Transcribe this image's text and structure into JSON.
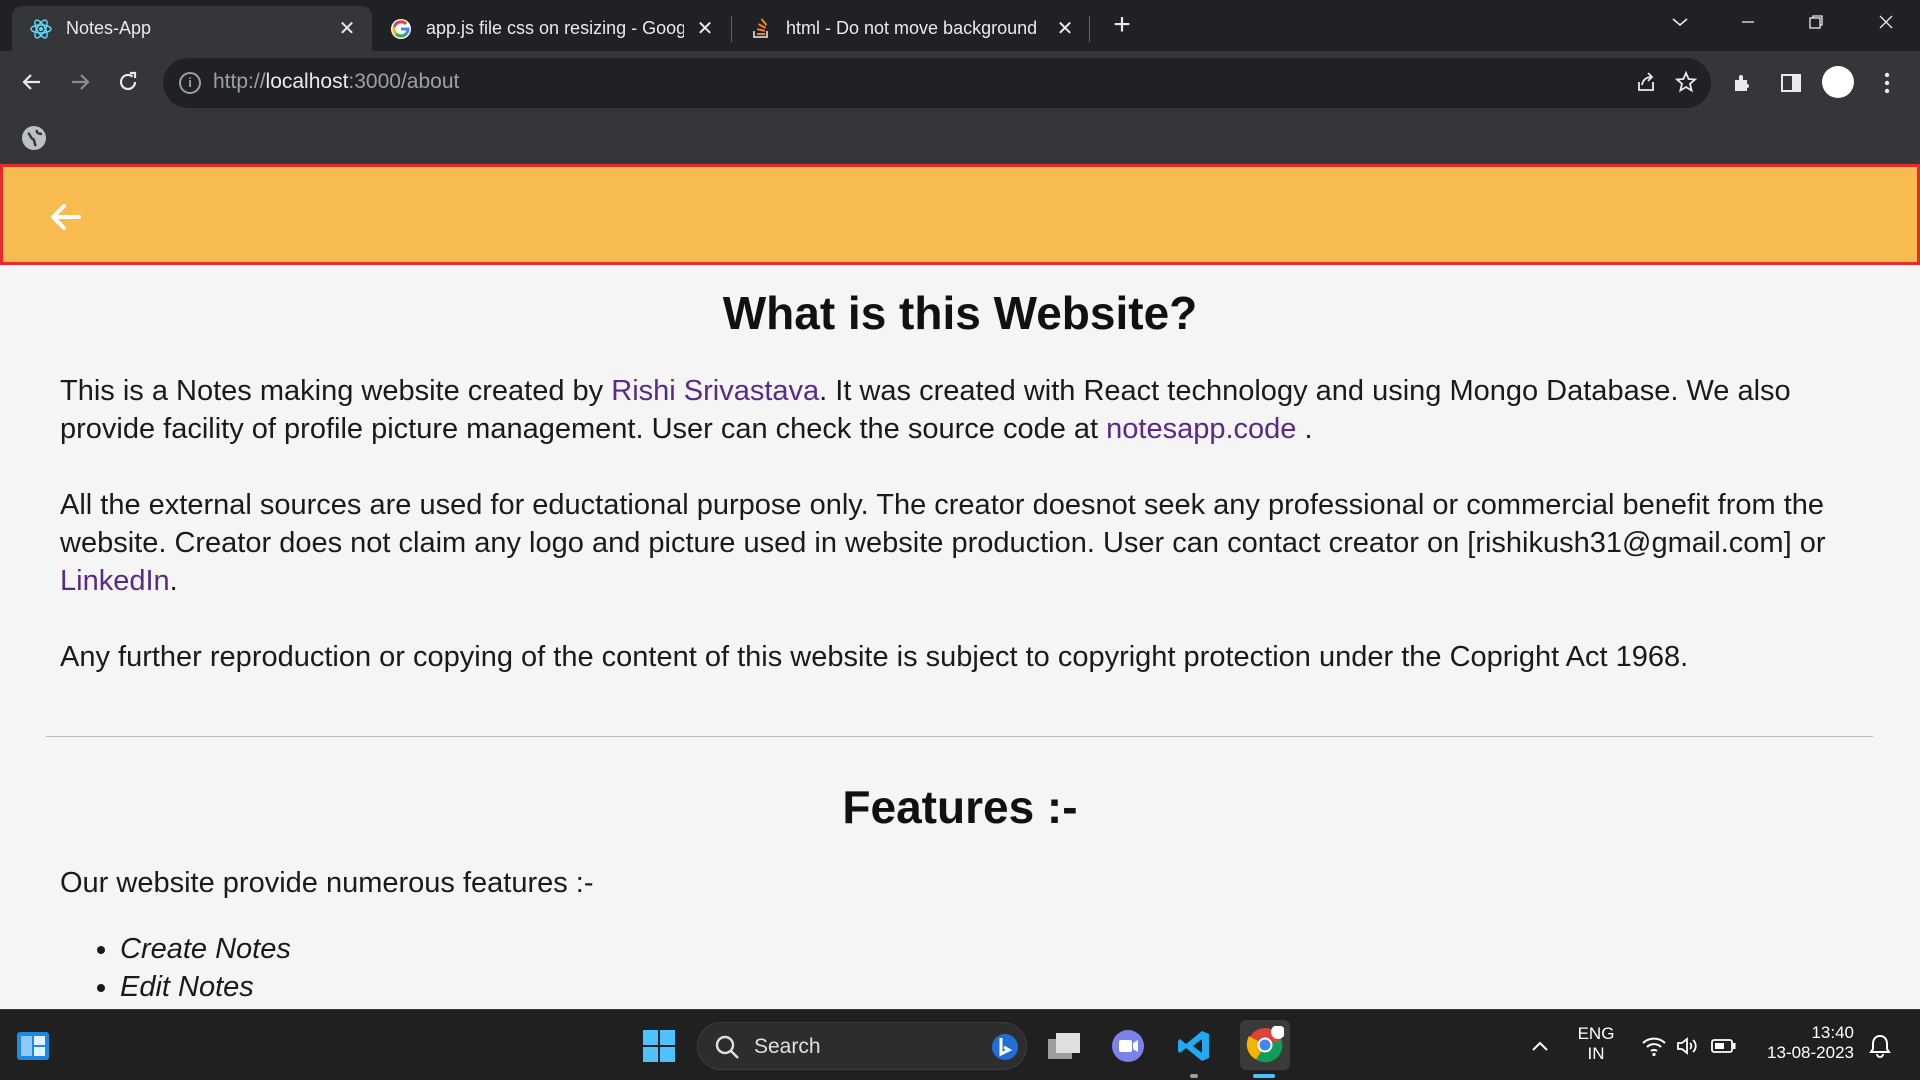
{
  "browser": {
    "tabs": [
      {
        "title": "Notes-App",
        "icon": "react-icon",
        "active": true
      },
      {
        "title": "app.js file css on resizing - Googl",
        "icon": "google-icon",
        "active": false
      },
      {
        "title": "html - Do not move background",
        "icon": "stackoverflow-icon",
        "active": false
      }
    ],
    "url_scheme": "http://",
    "url_host": "localhost",
    "url_rest": ":3000/about"
  },
  "page": {
    "heading": "What is this Website?",
    "p1_a": "This is a Notes making website created by ",
    "p1_link": "Rishi Srivastava",
    "p1_b": ". It was created with React technology and using Mongo Database. We also provide facility of profile picture management. User can check the source code at ",
    "p1_link2": "notesapp.code",
    "p1_c": " .",
    "p2_a": "All the external sources are used for eductational purpose only. The creator doesnot seek any professional or commercial benefit from the website. Creator does not claim any logo and picture used in website production. User can contact creator on [rishikush31@gmail.com] or ",
    "p2_link": "LinkedIn",
    "p2_b": ".",
    "p3": "Any further reproduction or copying of the content of this website is subject to copyright protection under the Copright Act 1968.",
    "features_heading": "Features :-",
    "features_intro": "Our website provide numerous features :-",
    "features": [
      "Create Notes",
      "Edit Notes"
    ]
  },
  "taskbar": {
    "search_label": "Search",
    "lang_top": "ENG",
    "lang_bottom": "IN",
    "time": "13:40",
    "date": "13-08-2023"
  },
  "colors": {
    "appbar": "#f7bb4f",
    "appbar_border": "#e52b2b",
    "link": "#5b2a86"
  }
}
